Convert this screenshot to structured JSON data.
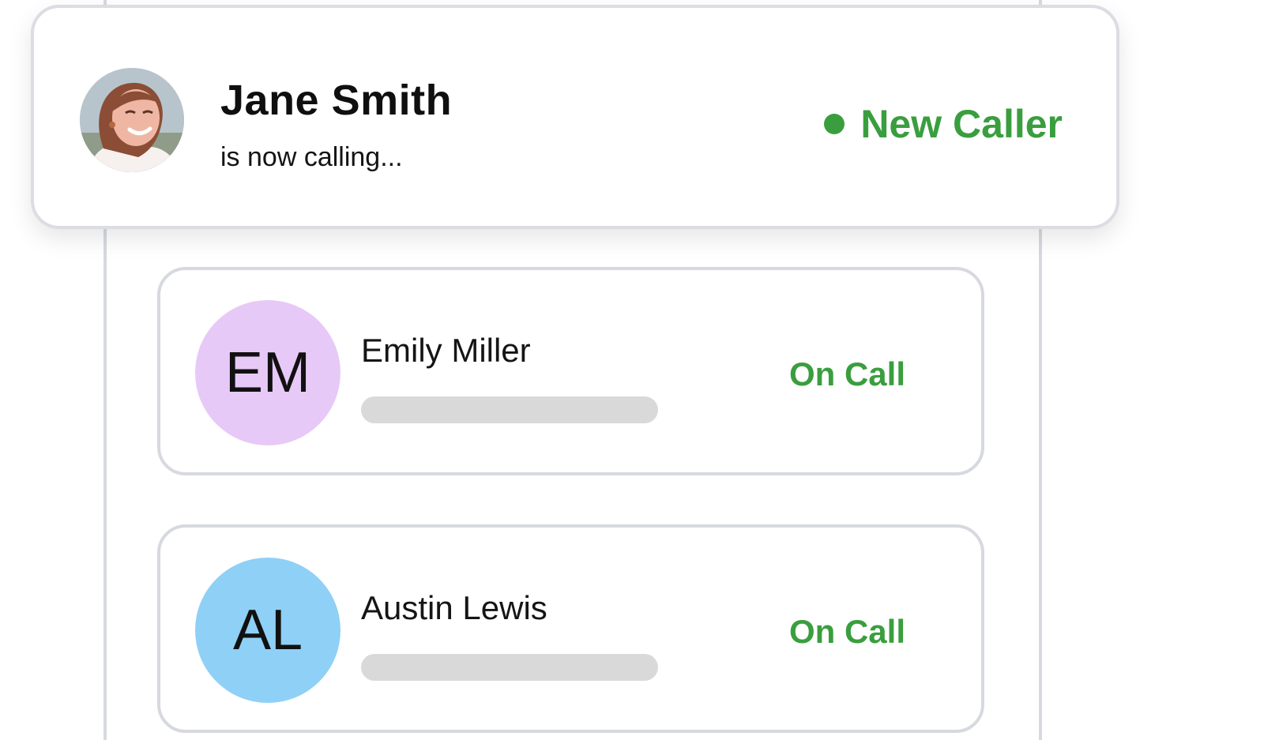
{
  "incoming_call": {
    "caller_name": "Jane Smith",
    "subtitle": "is now calling...",
    "status_label": "New Caller",
    "status_color": "#3a9e3e",
    "avatar_icon": "caller-photo"
  },
  "agents": [
    {
      "initials": "EM",
      "name": "Emily Miller",
      "status": "On Call",
      "avatar_color": "#e7c9f8"
    },
    {
      "initials": "AL",
      "name": "Austin Lewis",
      "status": "On Call",
      "avatar_color": "#8fd0f6"
    }
  ]
}
